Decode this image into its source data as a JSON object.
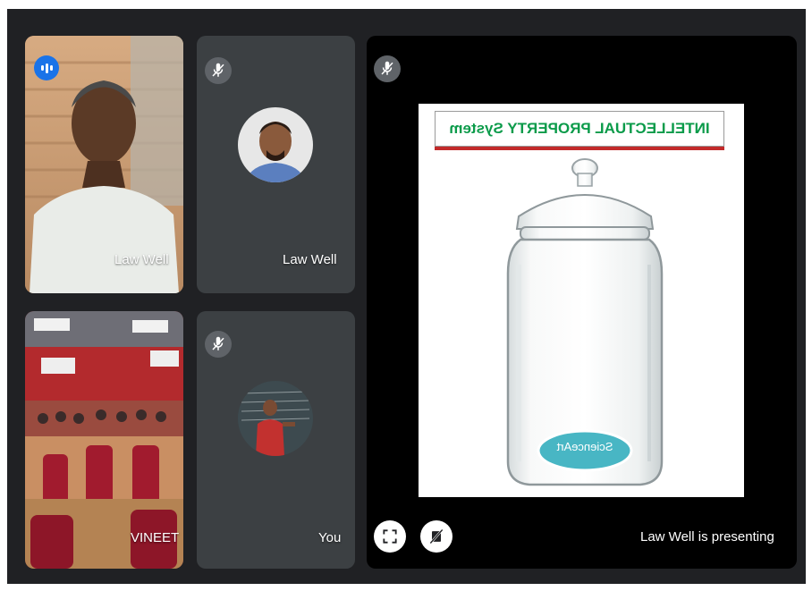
{
  "tiles": {
    "top_left": {
      "name": "Law Well"
    },
    "top_middle": {
      "name": "Law Well"
    },
    "bottom_left": {
      "name": "VINEET"
    },
    "bottom_middle": {
      "name": "You"
    }
  },
  "presentation": {
    "slide_title": "INTELLECTUAL PROPERTY System",
    "jar_label": "ScienceArt",
    "presenter_text": "Law Well is presenting"
  },
  "icons": {
    "speaking": "audio-level-icon",
    "mic_off": "mic-off-icon",
    "fullscreen": "fullscreen-icon",
    "stop_presenting": "stop-presenting-icon"
  },
  "colors": {
    "stage_bg": "#202124",
    "tile_bg": "#3c4043",
    "speaking_blue": "#1a73e8",
    "slide_title_green": "#0b9b4a",
    "jar_label_teal": "#48b6c4"
  }
}
